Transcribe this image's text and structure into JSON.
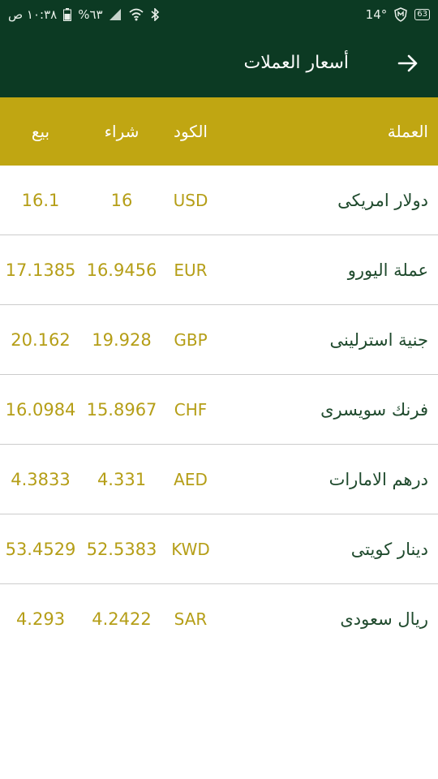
{
  "status_bar": {
    "time": "١٠:٣٨ ص",
    "battery": "%٦٣",
    "temperature": "14°",
    "badge": "63"
  },
  "app_bar": {
    "title": "أسعار العملات",
    "back_icon": "arrow-right-icon"
  },
  "table": {
    "headers": {
      "name": "العملة",
      "code": "الكود",
      "buy": "شراء",
      "sell": "بيع"
    },
    "rows": [
      {
        "name": "دولار امريكى",
        "code": "USD",
        "buy": "16",
        "sell": "16.1"
      },
      {
        "name": "عملة اليورو",
        "code": "EUR",
        "buy": "16.9456",
        "sell": "17.1385"
      },
      {
        "name": "جنية استرلينى",
        "code": "GBP",
        "buy": "19.928",
        "sell": "20.162"
      },
      {
        "name": "فرنك سويسرى",
        "code": "CHF",
        "buy": "15.8967",
        "sell": "16.0984"
      },
      {
        "name": "درهم الامارات",
        "code": "AED",
        "buy": "4.331",
        "sell": "4.3833"
      },
      {
        "name": "دينار كويتى",
        "code": "KWD",
        "buy": "52.5383",
        "sell": "53.4529"
      },
      {
        "name": "ريال سعودى",
        "code": "SAR",
        "buy": "4.2422",
        "sell": "4.293"
      }
    ]
  },
  "colors": {
    "bar": "#0c3a23",
    "header": "#c0a612",
    "value_text": "#b59e17",
    "name_text": "#1f4a2d"
  }
}
